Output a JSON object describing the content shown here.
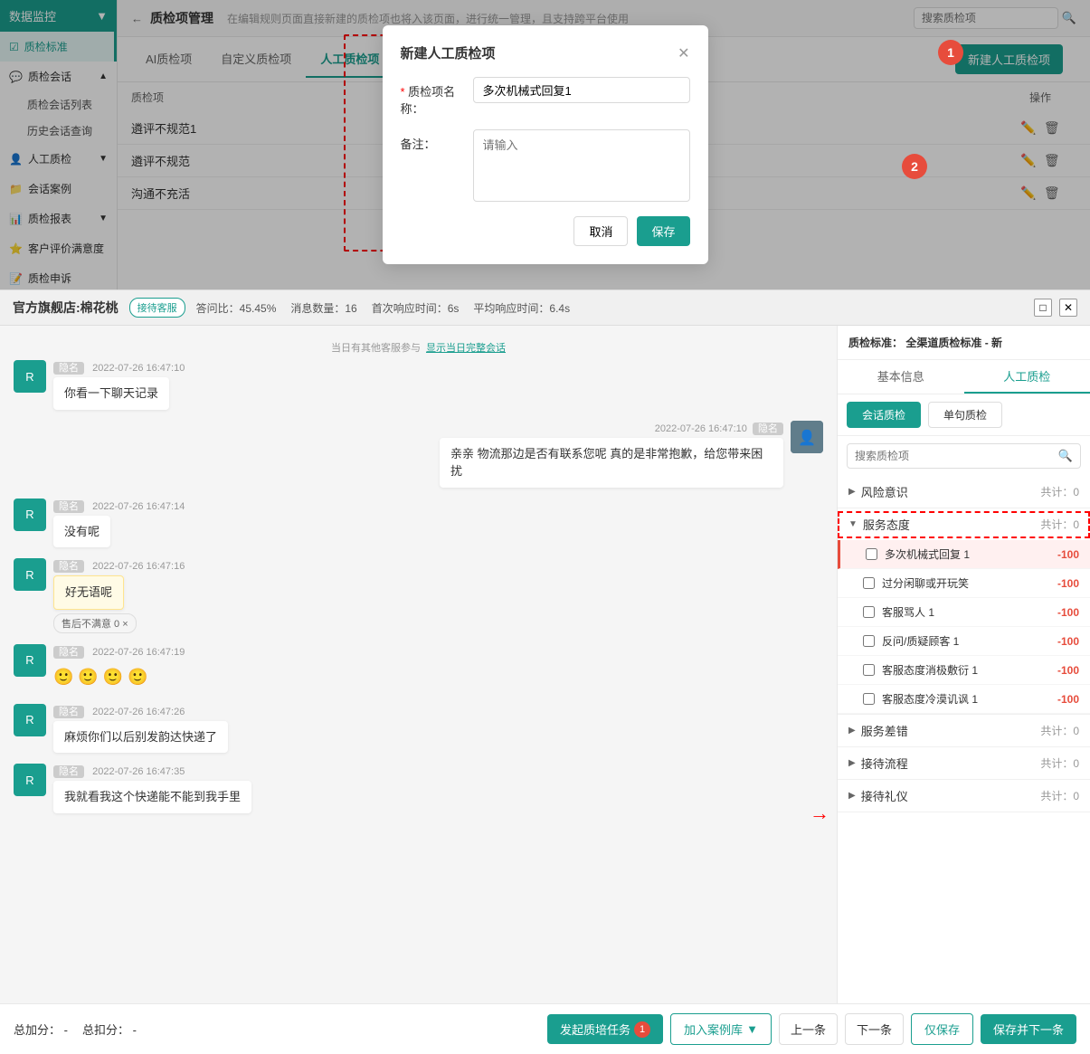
{
  "sidebar": {
    "header": "数据监控",
    "items": [
      {
        "id": "quality-standard",
        "label": "质检标准",
        "icon": "☑",
        "active": true
      },
      {
        "id": "quality-chat",
        "label": "质检会话",
        "icon": "💬",
        "active": false
      },
      {
        "id": "chat-list",
        "label": "质检会话列表",
        "sub": true
      },
      {
        "id": "history-chat",
        "label": "历史会话查询",
        "sub": true
      },
      {
        "id": "manual-quality",
        "label": "人工质检",
        "icon": "👤",
        "active": false
      },
      {
        "id": "chat-cases",
        "label": "会话案例",
        "icon": "📁",
        "active": false
      },
      {
        "id": "quality-report",
        "label": "质检报表",
        "icon": "📊",
        "active": false
      },
      {
        "id": "customer-satisfaction",
        "label": "客户评价满意度",
        "icon": "⭐",
        "active": false
      },
      {
        "id": "quality-appeal",
        "label": "质检申诉",
        "icon": "📝",
        "active": false
      }
    ]
  },
  "page": {
    "title": "质检项管理",
    "description": "在编辑规则页面直接新建的质检项也将入该页面，进行统一管理，且支持跨平台使用",
    "search_placeholder": "搜索质检项"
  },
  "tabs": {
    "items": [
      "AI质检项",
      "自定义质检项",
      "人工质检项"
    ],
    "active": 2
  },
  "table": {
    "col_name": "质检项",
    "col_op": "操作",
    "rows": [
      {
        "name": "遴评不规范1"
      },
      {
        "name": "遴评不规范"
      },
      {
        "name": "沟通不充活"
      }
    ]
  },
  "new_btn_label": "新建人工质检项",
  "modal": {
    "title": "新建人工质检项",
    "name_label": "质检项名称：",
    "name_value": "多次机械式回复1",
    "note_label": "备注：",
    "note_placeholder": "请输入",
    "cancel_label": "取消",
    "save_label": "保存",
    "annotation1": "1",
    "annotation2": "2"
  },
  "chat_window": {
    "shop_name": "官方旗舰店:棉花桃",
    "status": "接待客服",
    "stats": {
      "answer_rate": "答问比：45.45%",
      "msg_count": "消息数量：16",
      "first_response": "首次响应时间：6s",
      "avg_response": "平均响应时间：6.4s"
    },
    "other_notice": "当日有其他客服参与",
    "notice_link": "显示当日完整会话",
    "messages": [
      {
        "id": 1,
        "side": "left",
        "time": "2022-07-26 16:47:10",
        "text": "你看一下聊天记录",
        "type": "normal"
      },
      {
        "id": 2,
        "side": "right",
        "time": "2022-07-26 16:47:10",
        "text": "亲亲 物流那边是否有联系您呢 真的是非常抱歉，给您带来困扰",
        "type": "normal"
      },
      {
        "id": 3,
        "side": "left",
        "time": "2022-07-26 16:47:14",
        "text": "没有呢",
        "type": "normal"
      },
      {
        "id": 4,
        "side": "left",
        "time": "2022-07-26 16:47:16",
        "text": "好无语呢",
        "tag": "售后不满意 0 ×",
        "type": "highlight"
      },
      {
        "id": 5,
        "side": "left",
        "time": "2022-07-26 16:47:19",
        "text": "🙂 🙂 🙂 🙂",
        "type": "emoji"
      },
      {
        "id": 6,
        "side": "left",
        "time": "2022-07-26 16:47:26",
        "text": "麻烦你们以后别发韵达快递了",
        "type": "normal"
      },
      {
        "id": 7,
        "side": "left",
        "time": "2022-07-26 16:47:35",
        "text": "我就看我这个快递能不能到我手里",
        "type": "normal"
      }
    ]
  },
  "qc_panel": {
    "header_label": "质检标准：",
    "standard_name": "全渠道质检标准 - 新",
    "tab_basic": "基本信息",
    "tab_manual": "人工质检",
    "sub_tab_conversation": "会话质检",
    "sub_tab_sentence": "单句质检",
    "search_placeholder": "搜索质检项",
    "categories": [
      {
        "name": "风险意识",
        "count": "共计：0",
        "expanded": false,
        "items": []
      },
      {
        "name": "服务态度",
        "count": "共计：0",
        "expanded": true,
        "items": [
          {
            "name": "多次机械式回复 1",
            "score": "-100",
            "highlighted": true
          },
          {
            "name": "过分闲聊或开玩笑",
            "score": "-100"
          },
          {
            "name": "客服骂人 1",
            "score": "-100"
          },
          {
            "name": "反问/质疑顾客 1",
            "score": "-100"
          },
          {
            "name": "客服态度消极敷衍 1",
            "score": "-100"
          },
          {
            "name": "客服态度冷漠讥讽 1",
            "score": "-100"
          }
        ]
      },
      {
        "name": "服务差错",
        "count": "共计：0",
        "expanded": false,
        "items": []
      },
      {
        "name": "接待流程",
        "count": "共计：0",
        "expanded": false,
        "items": []
      },
      {
        "name": "接待礼仪",
        "count": "共计：0",
        "expanded": false,
        "items": []
      }
    ]
  },
  "bottom_toolbar": {
    "total_score_label": "总加分：",
    "total_score_value": "-",
    "total_deduct_label": "总扣分：",
    "total_deduct_value": "-",
    "launch_task_label": "发起质培任务",
    "task_badge": "1",
    "add_case_label": "加入案例库",
    "prev_label": "上一条",
    "next_label": "下一条",
    "save_only_label": "仅保存",
    "save_next_label": "保存并下一条"
  }
}
